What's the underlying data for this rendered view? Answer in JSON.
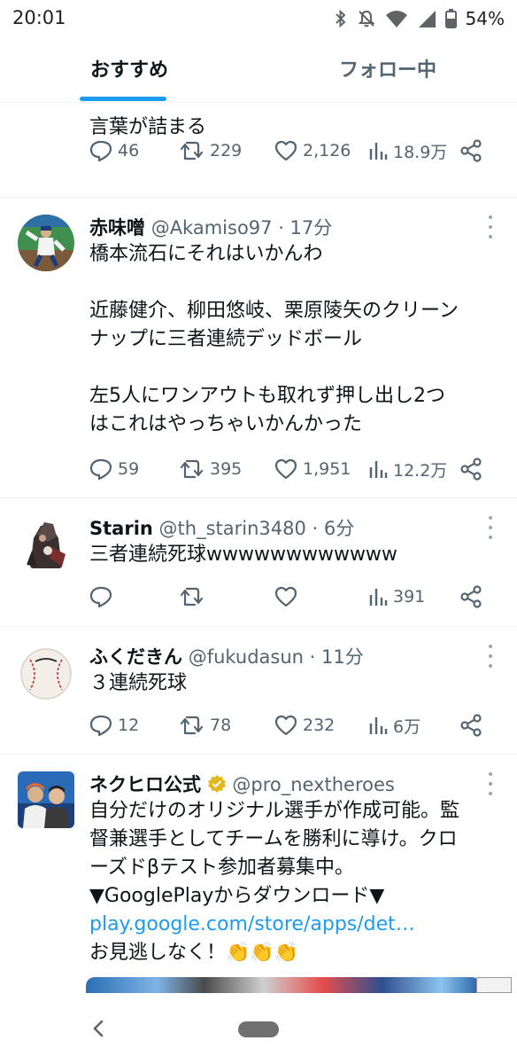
{
  "status_bar": {
    "time": "20:01",
    "battery": "54%",
    "icons": [
      "bluetooth-icon",
      "mute-icon",
      "wifi-icon",
      "signal-icon",
      "battery-icon"
    ]
  },
  "tabs": [
    {
      "label": "おすすめ",
      "active": true
    },
    {
      "label": "フォロー中",
      "active": false
    }
  ],
  "accent_color": "#1d9bf0",
  "tweets": [
    {
      "text_lines": [
        "言葉が詰まる"
      ],
      "reply": "46",
      "retweet": "229",
      "like": "2,126",
      "views": "18.9万"
    },
    {
      "name": "赤味噌",
      "handle": "@Akamiso97",
      "time": "· 17分",
      "text_lines": [
        "橋本流石にそれはいかんわ",
        "",
        "近藤健介、柳田悠岐、栗原陵矢のクリーン",
        "ナップに三者連続デッドボール",
        "",
        "左5人にワンアウトも取れず押し出し2つ",
        "はこれはやっちゃいかんかった"
      ],
      "reply": "59",
      "retweet": "395",
      "like": "1,951",
      "views": "12.2万"
    },
    {
      "name": "Starin",
      "handle": "@th_starin3480",
      "time": "· 6分",
      "text_lines": [
        "三者連続死球wwwwwwwwwwww"
      ],
      "reply": "",
      "retweet": "",
      "like": "",
      "views": "391"
    },
    {
      "name": "ふくだきん",
      "handle": "@fukudasun",
      "time": "· 11分",
      "text_lines": [
        "３連続死球"
      ],
      "reply": "12",
      "retweet": "78",
      "like": "232",
      "views": "6万"
    },
    {
      "name": "ネクヒロ公式",
      "handle": "@pro_nextheroes",
      "verified": true,
      "text_lines": [
        "自分だけのオリジナル選手が作成可能。監",
        "督兼選手としてチームを勝利に導け。クロ",
        "ーズドβテスト参加者募集中。",
        "▼GooglePlayからダウンロード▼"
      ],
      "link": "play.google.com/store/apps/det…",
      "after_link": "お見逃しなく！👏👏👏"
    }
  ]
}
